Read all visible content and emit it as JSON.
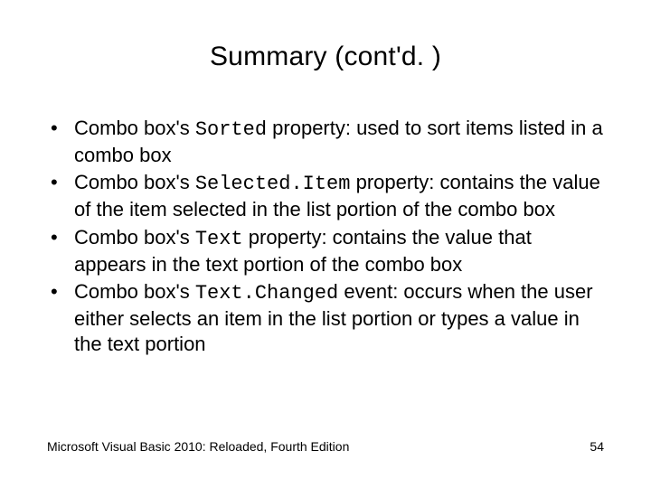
{
  "title": "Summary (cont'd. )",
  "bullets": [
    {
      "pre": "Combo box's ",
      "code": "Sorted",
      "post": " property: used to sort items listed in a combo box"
    },
    {
      "pre": "Combo box's ",
      "code": "Selected.Item",
      "post": " property: contains the value of the item selected in the list portion of the combo box"
    },
    {
      "pre": "Combo box's ",
      "code": "Text",
      "post": " property: contains the value that appears in the text portion of the combo box"
    },
    {
      "pre": "Combo box's ",
      "code": "Text.Changed",
      "post": " event: occurs when the user either selects an item in the list portion or types a value in the text portion"
    }
  ],
  "footer": {
    "left": "Microsoft Visual Basic 2010: Reloaded, Fourth Edition",
    "right": "54"
  }
}
